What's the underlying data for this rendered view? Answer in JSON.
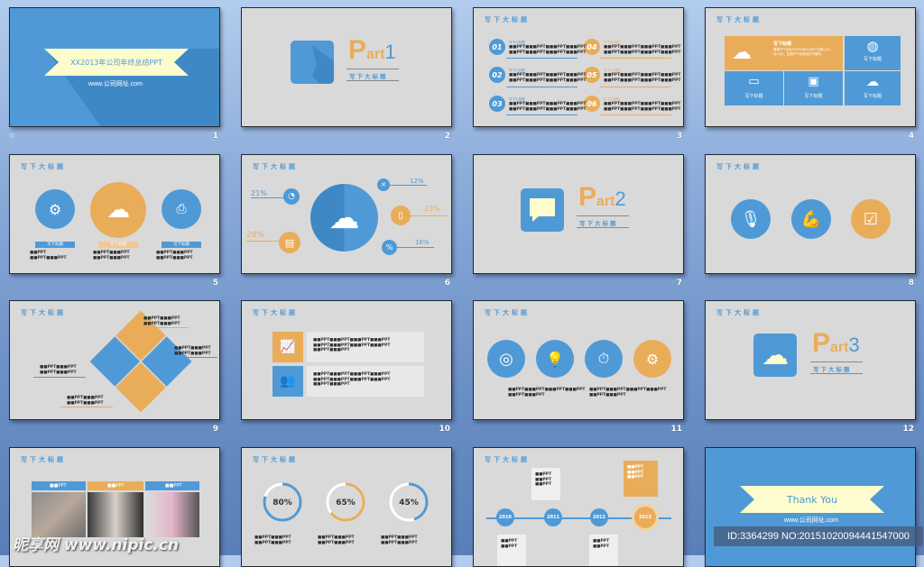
{
  "heading": "写下大标题",
  "subheading": "写下小标题",
  "label": "写下标题",
  "filler": "■■PPT■■■PPT■■■PPT■■■PPT",
  "short_filler": "■■PPT■■■PPT",
  "colors": {
    "blue": "#4f9ad6",
    "orange": "#e9ad5a",
    "ribbon": "#fdfccc",
    "slide_bg": "#d9d9d9"
  },
  "slide_numbers": [
    "1",
    "2",
    "3",
    "4",
    "5",
    "6",
    "7",
    "8",
    "9",
    "10",
    "11",
    "12"
  ],
  "slide_icon": "star-icon",
  "s1": {
    "title": "XX2013年公司年终总结PPT",
    "url": "www.公司网址.com"
  },
  "parts": [
    {
      "p": "P",
      "art": "art",
      "n": "1"
    },
    {
      "p": "P",
      "art": "art",
      "n": "2"
    },
    {
      "p": "P",
      "art": "art",
      "n": "3"
    }
  ],
  "s3": {
    "numbers": [
      "01",
      "02",
      "03",
      "04",
      "05",
      "06"
    ]
  },
  "s4": {
    "body": "着着PPT论坛于2013年10月21日晚上23点40分，回放PPT老师送花不懂完。"
  },
  "s6": {
    "percents": [
      "21%",
      "28%",
      "12%",
      "23%",
      "16%"
    ]
  },
  "s13": {
    "tab_label": "■■PPT"
  },
  "s14": {
    "rings": [
      {
        "label": "80%",
        "value": 80,
        "color": "#4f9ad6"
      },
      {
        "label": "65%",
        "value": 65,
        "color": "#e9ad5a"
      },
      {
        "label": "45%",
        "value": 45,
        "color": "#4f9ad6"
      }
    ]
  },
  "s15": {
    "years": [
      "2010",
      "2011",
      "2012",
      "2013"
    ]
  },
  "s16": {
    "title": "Thank You",
    "url": "www.公司网址.com"
  },
  "watermark": {
    "id": "ID:3364299 NO:20151020094441547000",
    "site": "昵享网 www.nipic.cn"
  }
}
